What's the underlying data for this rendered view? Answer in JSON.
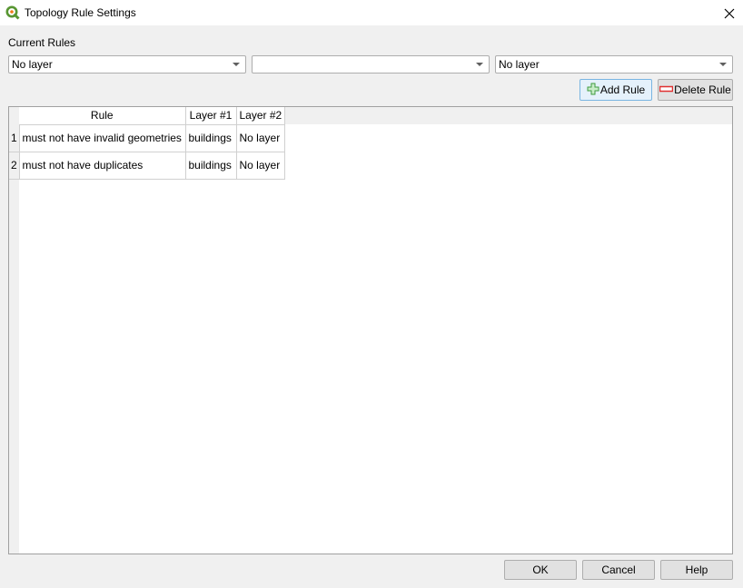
{
  "window": {
    "title": "Topology Rule Settings",
    "app_icon": "qgis-logo-icon",
    "close_icon": "close-icon"
  },
  "current_rules_label": "Current Rules",
  "selectors": {
    "layer1": {
      "value": "No layer"
    },
    "rule": {
      "value": ""
    },
    "layer2": {
      "value": "No layer"
    }
  },
  "toolbar": {
    "add_rule_label": "Add Rule",
    "add_rule_icon": "plus-icon",
    "delete_rule_label": "Delete Rule",
    "delete_rule_icon": "minus-icon"
  },
  "table": {
    "columns": [
      "Rule",
      "Layer #1",
      "Layer #2"
    ],
    "rows": [
      {
        "num": "1",
        "rule": "must not have invalid geometries",
        "layer1": "buildings",
        "layer2": "No layer"
      },
      {
        "num": "2",
        "rule": "must not have duplicates",
        "layer1": "buildings",
        "layer2": "No layer"
      }
    ]
  },
  "footer": {
    "ok_label": "OK",
    "cancel_label": "Cancel",
    "help_label": "Help"
  },
  "colors": {
    "qgis_green": "#589632",
    "qgis_yellow": "#ee7913",
    "add_green": "#3f9b3f",
    "delete_red": "#e03030"
  }
}
